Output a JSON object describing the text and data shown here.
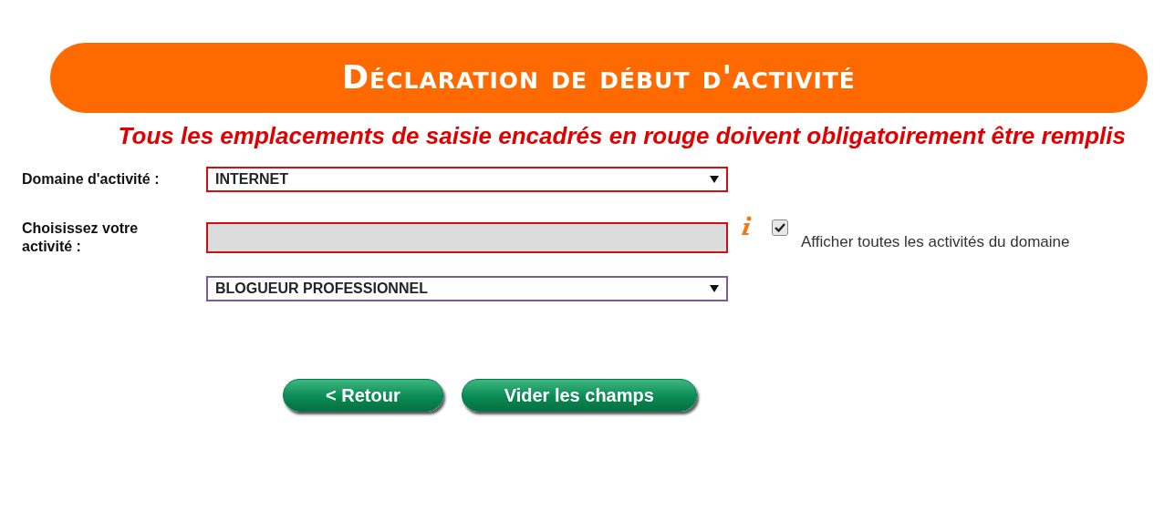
{
  "header": {
    "title": "Déclaration de début d'activité"
  },
  "notice": "Tous les emplacements de saisie encadrés en rouge doivent obligatoirement être remplis",
  "fields": [
    {
      "kind": "select",
      "label": "Domaine d'activité :",
      "value": "INTERNET",
      "required": true
    },
    {
      "kind": "text",
      "label": "Choisissez votre activité :",
      "required": true,
      "disabled": true,
      "checkbox": {
        "label": "Afficher toutes les activités du domaine",
        "checked": true
      }
    },
    {
      "kind": "select",
      "value": "BLOGUEUR PROFESSIONNEL",
      "required": false
    }
  ],
  "buttons": [
    "< Retour",
    "Vider les champs"
  ]
}
